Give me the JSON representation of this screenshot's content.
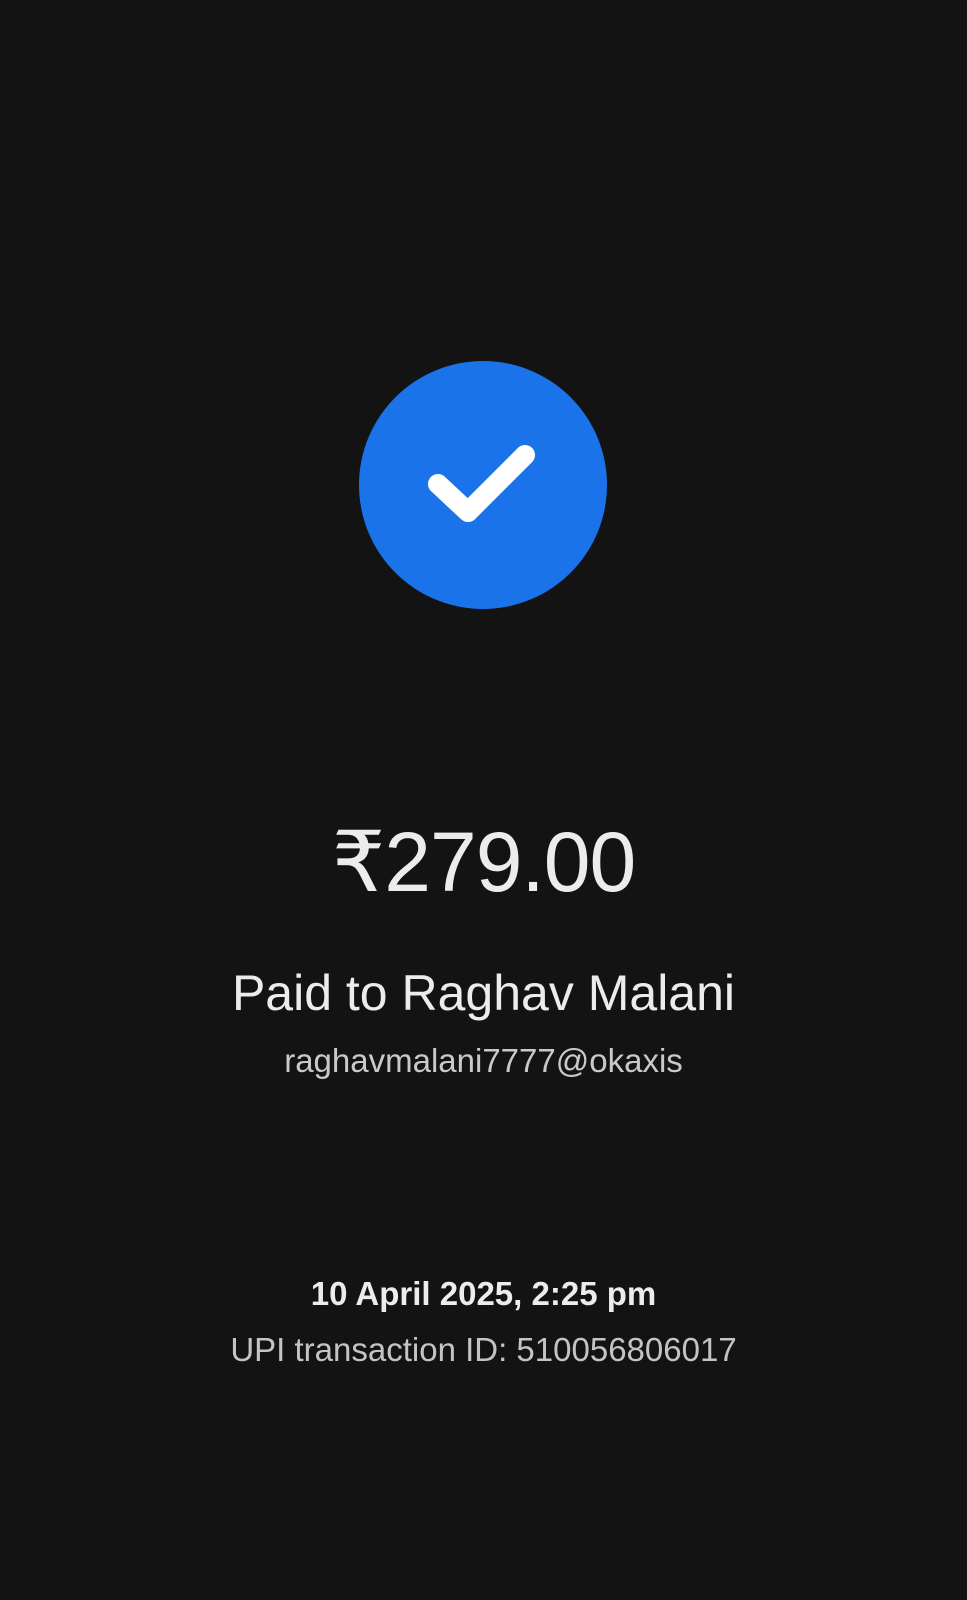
{
  "colors": {
    "background": "#131313",
    "accent": "#1a73e8",
    "check": "#ffffff"
  },
  "icons": {
    "status": "check-icon"
  },
  "payment": {
    "amount": "₹279.00",
    "paid_to": "Paid to Raghav Malani",
    "upi_id": "raghavmalani7777@okaxis",
    "datetime": "10 April 2025, 2:25 pm",
    "transaction_id": "UPI transaction ID: 510056806017"
  }
}
